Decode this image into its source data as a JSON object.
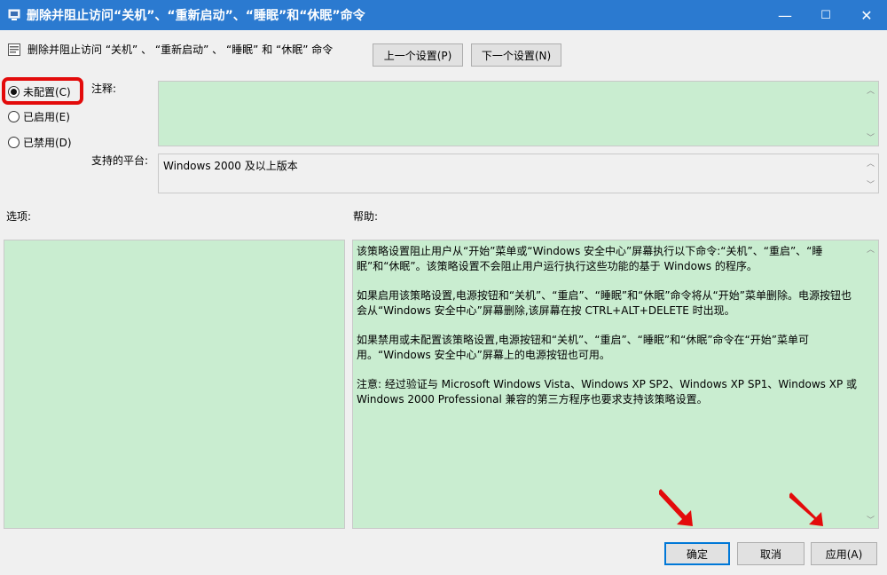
{
  "window": {
    "title": "删除并阻止访问“关机”、“重新启动”、“睡眠”和“休眠”命令",
    "minimize": "—",
    "maximize": "☐",
    "close": "✕"
  },
  "header": {
    "policy_name": "删除并阻止访问 “关机” 、 “重新启动” 、 “睡眠” 和 “休眠” 命令",
    "prev_button": "上一个设置(P)",
    "next_button": "下一个设置(N)"
  },
  "state": {
    "options": [
      {
        "label": "未配置(C)",
        "checked": true
      },
      {
        "label": "已启用(E)",
        "checked": false
      },
      {
        "label": "已禁用(D)",
        "checked": false
      }
    ]
  },
  "comment": {
    "label": "注释:",
    "value": ""
  },
  "platform": {
    "label": "支持的平台:",
    "value": "Windows 2000 及以上版本"
  },
  "options_section": {
    "label": "选项:"
  },
  "help_section": {
    "label": "帮助:",
    "paragraphs": [
      "该策略设置阻止用户从“开始”菜单或“Windows 安全中心”屏幕执行以下命令:“关机”、“重启”、“睡眠”和“休眠”。该策略设置不会阻止用户运行执行这些功能的基于 Windows 的程序。",
      "如果启用该策略设置,电源按钮和“关机”、“重启”、“睡眠”和“休眠”命令将从“开始”菜单删除。电源按钮也会从“Windows 安全中心”屏幕删除,该屏幕在按 CTRL+ALT+DELETE 时出现。",
      "如果禁用或未配置该策略设置,电源按钮和“关机”、“重启”、“睡眠”和“休眠”命令在“开始”菜单可用。“Windows 安全中心”屏幕上的电源按钮也可用。",
      "注意: 经过验证与 Microsoft Windows Vista、Windows XP SP2、Windows XP SP1、Windows XP 或 Windows 2000 Professional 兼容的第三方程序也要求支持该策略设置。"
    ]
  },
  "footer": {
    "ok_button": "确定",
    "cancel_button": "取消",
    "apply_button": "应用(A)"
  },
  "colors": {
    "titlebar": "#2b7ad0",
    "field_green": "#c9edd0",
    "highlight_red": "#e30b0b"
  }
}
